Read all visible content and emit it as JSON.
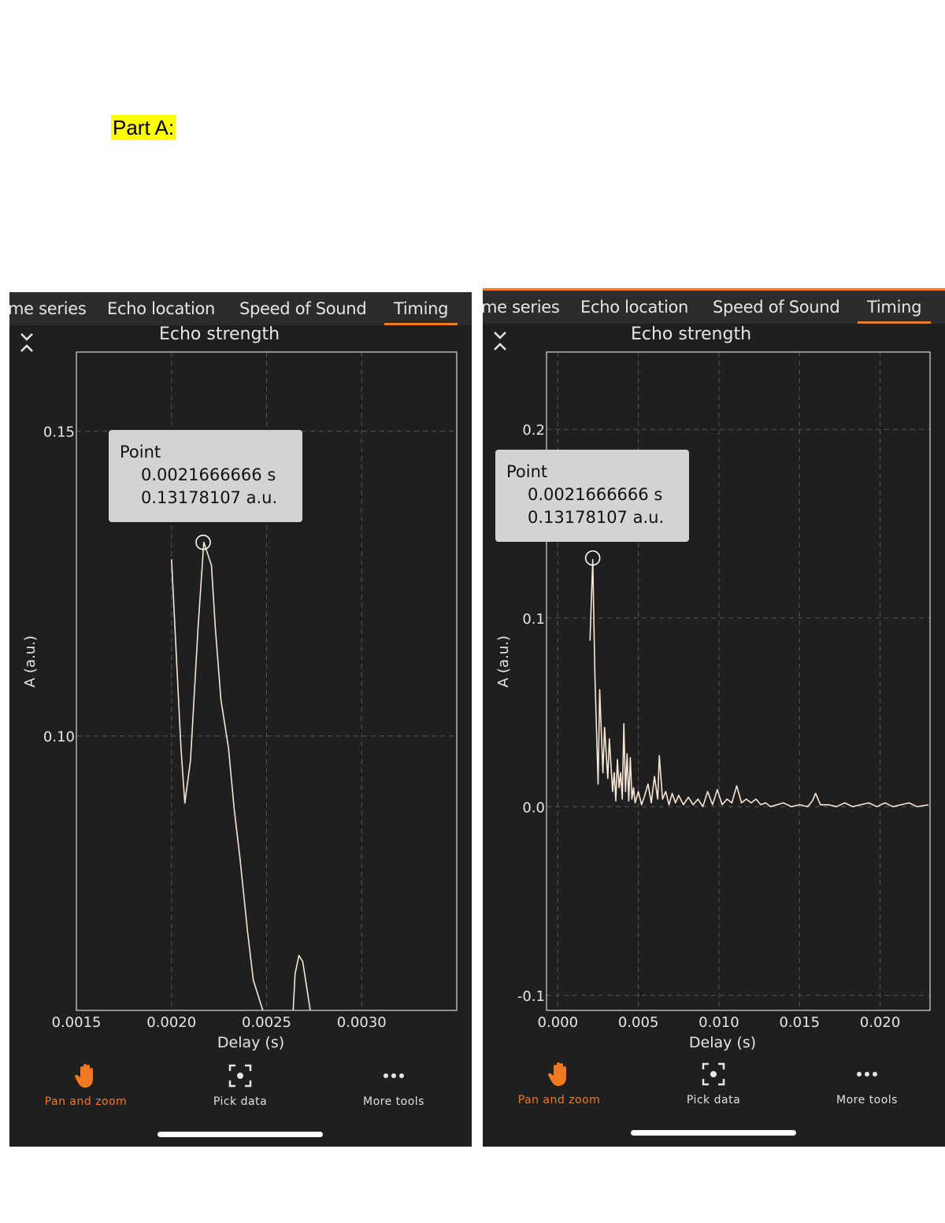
{
  "part_label": "Part A:",
  "tabs": [
    "me series",
    "Echo location",
    "Speed of Sound",
    "Timing"
  ],
  "active_tab": "Timing",
  "chart_title": "Echo strength",
  "tooltip": {
    "title": "Point",
    "x_value": "0.0021666666 s",
    "y_value": "0.13178107 a.u."
  },
  "tools": [
    {
      "label": "Pan and zoom",
      "icon": "hand-icon",
      "active": true
    },
    {
      "label": "Pick data",
      "icon": "target-icon",
      "active": false
    },
    {
      "label": "More tools",
      "icon": "more-dots-icon",
      "active": false
    }
  ],
  "colors": {
    "accent": "#f07a22",
    "background": "#1f1f1f",
    "trace": "#f5e6d6",
    "tooltip": "#d3d3d3"
  },
  "chart_data": [
    {
      "type": "line",
      "title": "Echo strength",
      "xlabel": "Delay (s)",
      "ylabel": "A (a.u.)",
      "xlim": [
        0.0015,
        0.0035
      ],
      "ylim": [
        0.055,
        0.163
      ],
      "xticks": [
        0.0015,
        0.002,
        0.0025,
        0.003
      ],
      "xtick_labels": [
        "0.0015",
        "0.0020",
        "0.0025",
        "0.0030"
      ],
      "yticks": [
        0.1,
        0.15
      ],
      "ytick_labels": [
        "0.10",
        "0.15"
      ],
      "grid": true,
      "selected_point": {
        "x": 0.0021666666,
        "y": 0.13178107
      },
      "series": [
        {
          "x": [
            0.002,
            0.00205,
            0.00207,
            0.0021,
            0.00214,
            0.00217,
            0.00221,
            0.00223,
            0.00226,
            0.0023,
            0.00233,
            0.00236,
            0.0024,
            0.00243,
            0.00248
          ],
          "y": [
            0.129,
            0.098,
            0.089,
            0.096,
            0.118,
            0.1318,
            0.128,
            0.118,
            0.106,
            0.098,
            0.088,
            0.08,
            0.068,
            0.06,
            0.055
          ]
        },
        {
          "x": [
            0.00264,
            0.00265,
            0.00267,
            0.00269,
            0.00271,
            0.00273
          ],
          "y": [
            0.055,
            0.061,
            0.064,
            0.063,
            0.059,
            0.055
          ]
        }
      ]
    },
    {
      "type": "line",
      "title": "Echo strength",
      "xlabel": "Delay (s)",
      "ylabel": "A (a.u.)",
      "xlim": [
        -0.0007,
        0.0231
      ],
      "ylim": [
        -0.108,
        0.241
      ],
      "xticks": [
        0,
        0.005,
        0.01,
        0.015,
        0.02
      ],
      "xtick_labels": [
        "0.000",
        "0.005",
        "0.010",
        "0.015",
        "0.020"
      ],
      "yticks": [
        -0.1,
        0,
        0.1,
        0.2
      ],
      "ytick_labels": [
        "-0.1",
        "0.0",
        "0.1",
        "0.2"
      ],
      "grid": true,
      "selected_point": {
        "x": 0.0021666666,
        "y": 0.13178107
      },
      "series": [
        {
          "x": [
            0.002,
            0.00217,
            0.0023,
            0.0025,
            0.0026,
            0.0028,
            0.0029,
            0.0031,
            0.0032,
            0.0034,
            0.0035,
            0.0036,
            0.0037,
            0.0038,
            0.0039,
            0.004,
            0.0041,
            0.0042,
            0.0043,
            0.0044,
            0.0045,
            0.0046,
            0.0047,
            0.0048,
            0.005,
            0.0052,
            0.0054,
            0.0056,
            0.0058,
            0.006,
            0.0062,
            0.0063,
            0.0065,
            0.0067,
            0.0069,
            0.0071,
            0.0073,
            0.0075,
            0.0078,
            0.0081,
            0.0084,
            0.0087,
            0.009,
            0.0093,
            0.0096,
            0.0099,
            0.0102,
            0.0105,
            0.0108,
            0.0111,
            0.0114,
            0.0117,
            0.012,
            0.0123,
            0.0126,
            0.0129,
            0.0132,
            0.0136,
            0.014,
            0.0145,
            0.015,
            0.0155,
            0.0158,
            0.016,
            0.0163,
            0.0168,
            0.0173,
            0.0178,
            0.0183,
            0.0188,
            0.0193,
            0.0198,
            0.0203,
            0.0208,
            0.0213,
            0.0218,
            0.0223,
            0.023
          ],
          "y": [
            0.088,
            0.131,
            0.07,
            0.012,
            0.062,
            0.018,
            0.042,
            0.015,
            0.036,
            0.008,
            0.018,
            0.003,
            0.025,
            0.01,
            0.018,
            0.004,
            0.044,
            0.008,
            0.028,
            0.003,
            0.026,
            0.004,
            0.01,
            0.002,
            0.008,
            0.001,
            0.006,
            0.012,
            0.002,
            0.016,
            0.004,
            0.027,
            0.004,
            0.008,
            0.001,
            0.007,
            0.002,
            0.006,
            0.001,
            0.005,
            0.001,
            0.004,
            0.0,
            0.008,
            0.001,
            0.009,
            0.001,
            0.004,
            0.002,
            0.011,
            0.002,
            0.004,
            0.002,
            0.004,
            0.001,
            0.002,
            0.0,
            0.001,
            0.002,
            0.0,
            0.001,
            0.0,
            0.003,
            0.007,
            0.001,
            0.001,
            0.0,
            0.002,
            0.0,
            0.001,
            0.002,
            0.0,
            0.002,
            0.0,
            0.001,
            0.002,
            0.0,
            0.001
          ]
        }
      ]
    }
  ]
}
